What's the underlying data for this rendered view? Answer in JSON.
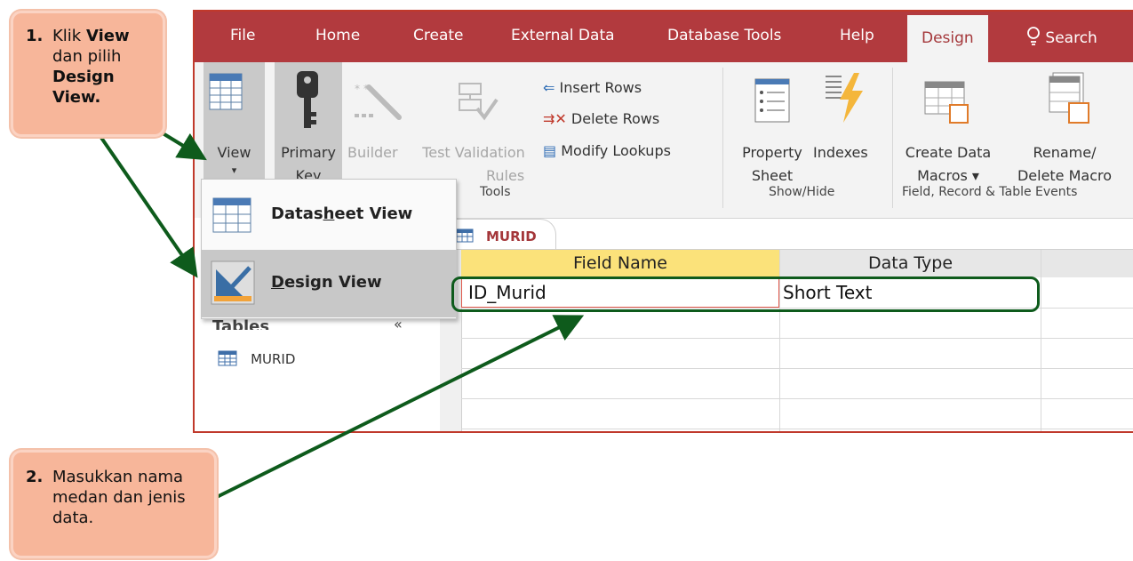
{
  "tabs": [
    "File",
    "Home",
    "Create",
    "External Data",
    "Database Tools",
    "Help",
    "Design"
  ],
  "search": {
    "label": "Search"
  },
  "ribbon": {
    "view": {
      "line1": "View",
      "line2": "▾"
    },
    "primary_key": {
      "line1": "Primary",
      "line2": "Key"
    },
    "builder": "Builder",
    "test_validation": {
      "line1": "Test Validation",
      "line2": "Rules"
    },
    "insert_rows": "Insert Rows",
    "delete_rows": "Delete Rows",
    "modify_lookups": "Modify Lookups",
    "property_sheet": {
      "line1": "Property",
      "line2": "Sheet"
    },
    "indexes": "Indexes",
    "create_data_macros": {
      "line1": "Create Data",
      "line2": "Macros ▾"
    },
    "rename_delete_macro": {
      "line1": "Rename/",
      "line2": "Delete Macro"
    },
    "groups": {
      "tools": "Tools",
      "show_hide": "Show/Hide",
      "events": "Field, Record & Table Events"
    }
  },
  "view_menu": {
    "datasheet": {
      "pre": "Datas",
      "key": "h",
      "post": "eet View"
    },
    "design": {
      "key": "D",
      "post": "esign View"
    }
  },
  "nav": {
    "section": "Tables",
    "section_close": "«",
    "item": "MURID"
  },
  "document": {
    "tab": "MURID"
  },
  "grid": {
    "headers": [
      "Field Name",
      "Data Type"
    ],
    "rows": [
      {
        "field": "ID_Murid",
        "type": "Short Text"
      }
    ]
  },
  "callout1": {
    "num": "1.",
    "t1": "Klik ",
    "b1": "View",
    "t2": "dan pilih",
    "b2": "Design",
    "b3": "View."
  },
  "callout2": {
    "num": "2.",
    "t1": "Masukkan nama",
    "t2": "medan dan jenis",
    "t3": "data."
  },
  "colors": {
    "accent": "#b23a3e",
    "callout": "#f7b69a",
    "arrow": "#0e5b1c",
    "header_highlight": "#fbe27a"
  }
}
